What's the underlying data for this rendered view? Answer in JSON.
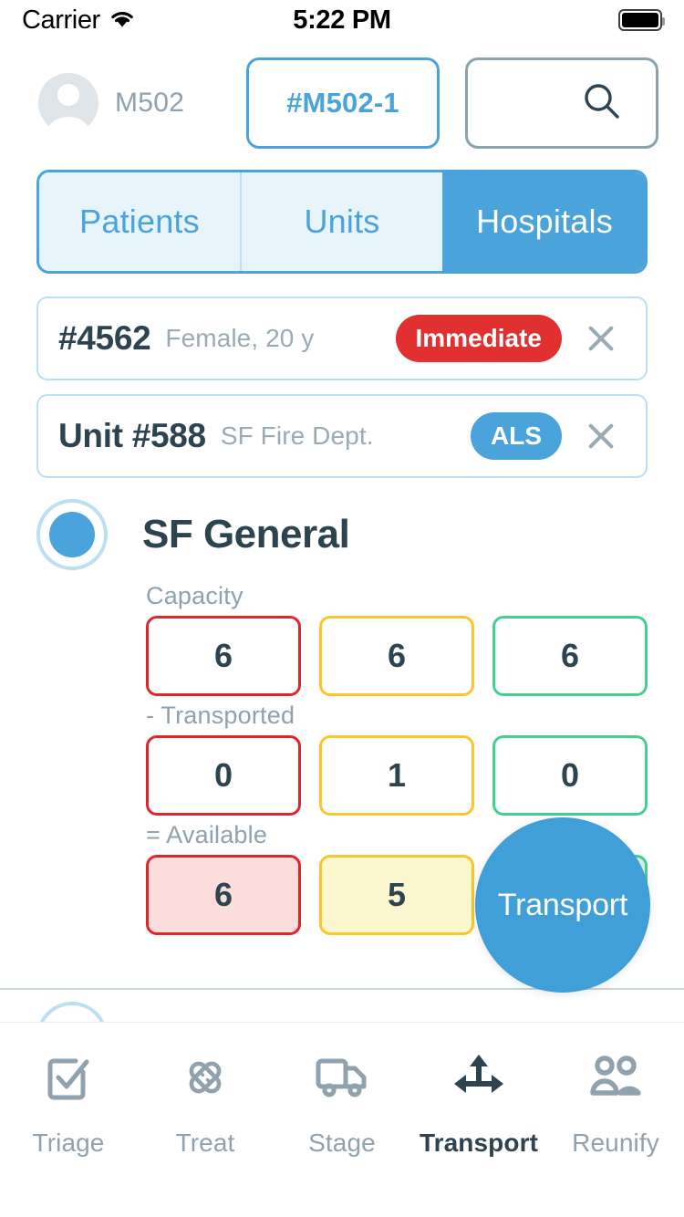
{
  "status_bar": {
    "carrier": "Carrier",
    "wifi_icon": "wifi-icon",
    "time": "5:22 PM",
    "battery_icon": "battery-full-icon"
  },
  "header": {
    "avatar_icon": "user-avatar-icon",
    "user_label": "M502",
    "incident_chip": "#M502-1",
    "search_icon": "search-icon"
  },
  "tabs": [
    {
      "label": "Patients",
      "active": false
    },
    {
      "label": "Units",
      "active": false
    },
    {
      "label": "Hospitals",
      "active": true
    }
  ],
  "selection": {
    "patient": {
      "id": "#4562",
      "subtitle": "Female, 20 y",
      "badge": "Immediate",
      "badge_color": "#e03030",
      "clear_icon": "close-x-icon"
    },
    "unit": {
      "id": "Unit #588",
      "subtitle": "SF Fire Dept.",
      "badge": "ALS",
      "badge_color": "#4aa3db",
      "clear_icon": "close-x-icon"
    }
  },
  "hospital": {
    "selected": true,
    "name": "SF General",
    "rows": [
      {
        "label": "Capacity",
        "filled": false,
        "boxes": [
          {
            "color": "red",
            "value": "6"
          },
          {
            "color": "yellow",
            "value": "6"
          },
          {
            "color": "green",
            "value": "6"
          }
        ]
      },
      {
        "label": "- Transported",
        "filled": false,
        "boxes": [
          {
            "color": "red",
            "value": "0"
          },
          {
            "color": "yellow",
            "value": "1"
          },
          {
            "color": "green",
            "value": "0"
          }
        ]
      },
      {
        "label": "= Available",
        "filled": true,
        "boxes": [
          {
            "color": "red",
            "value": "6"
          },
          {
            "color": "yellow",
            "value": "5"
          },
          {
            "color": "green",
            "value": ""
          }
        ]
      }
    ]
  },
  "transport_button": {
    "label": "Transport",
    "color": "#3f9fd6"
  },
  "bottom_nav": [
    {
      "label": "Triage",
      "icon": "clipboard-check-icon",
      "active": false
    },
    {
      "label": "Treat",
      "icon": "bandages-icon",
      "active": false
    },
    {
      "label": "Stage",
      "icon": "truck-icon",
      "active": false
    },
    {
      "label": "Transport",
      "icon": "three-way-arrow-icon",
      "active": true
    },
    {
      "label": "Reunify",
      "icon": "two-people-icon",
      "active": false
    }
  ],
  "colors": {
    "accent": "#4aa3db",
    "red": "#e0262b",
    "yellow": "#fbc52d",
    "green": "#45cf8e",
    "text_dark": "#2d4450",
    "text_muted": "#8fa2ad"
  }
}
